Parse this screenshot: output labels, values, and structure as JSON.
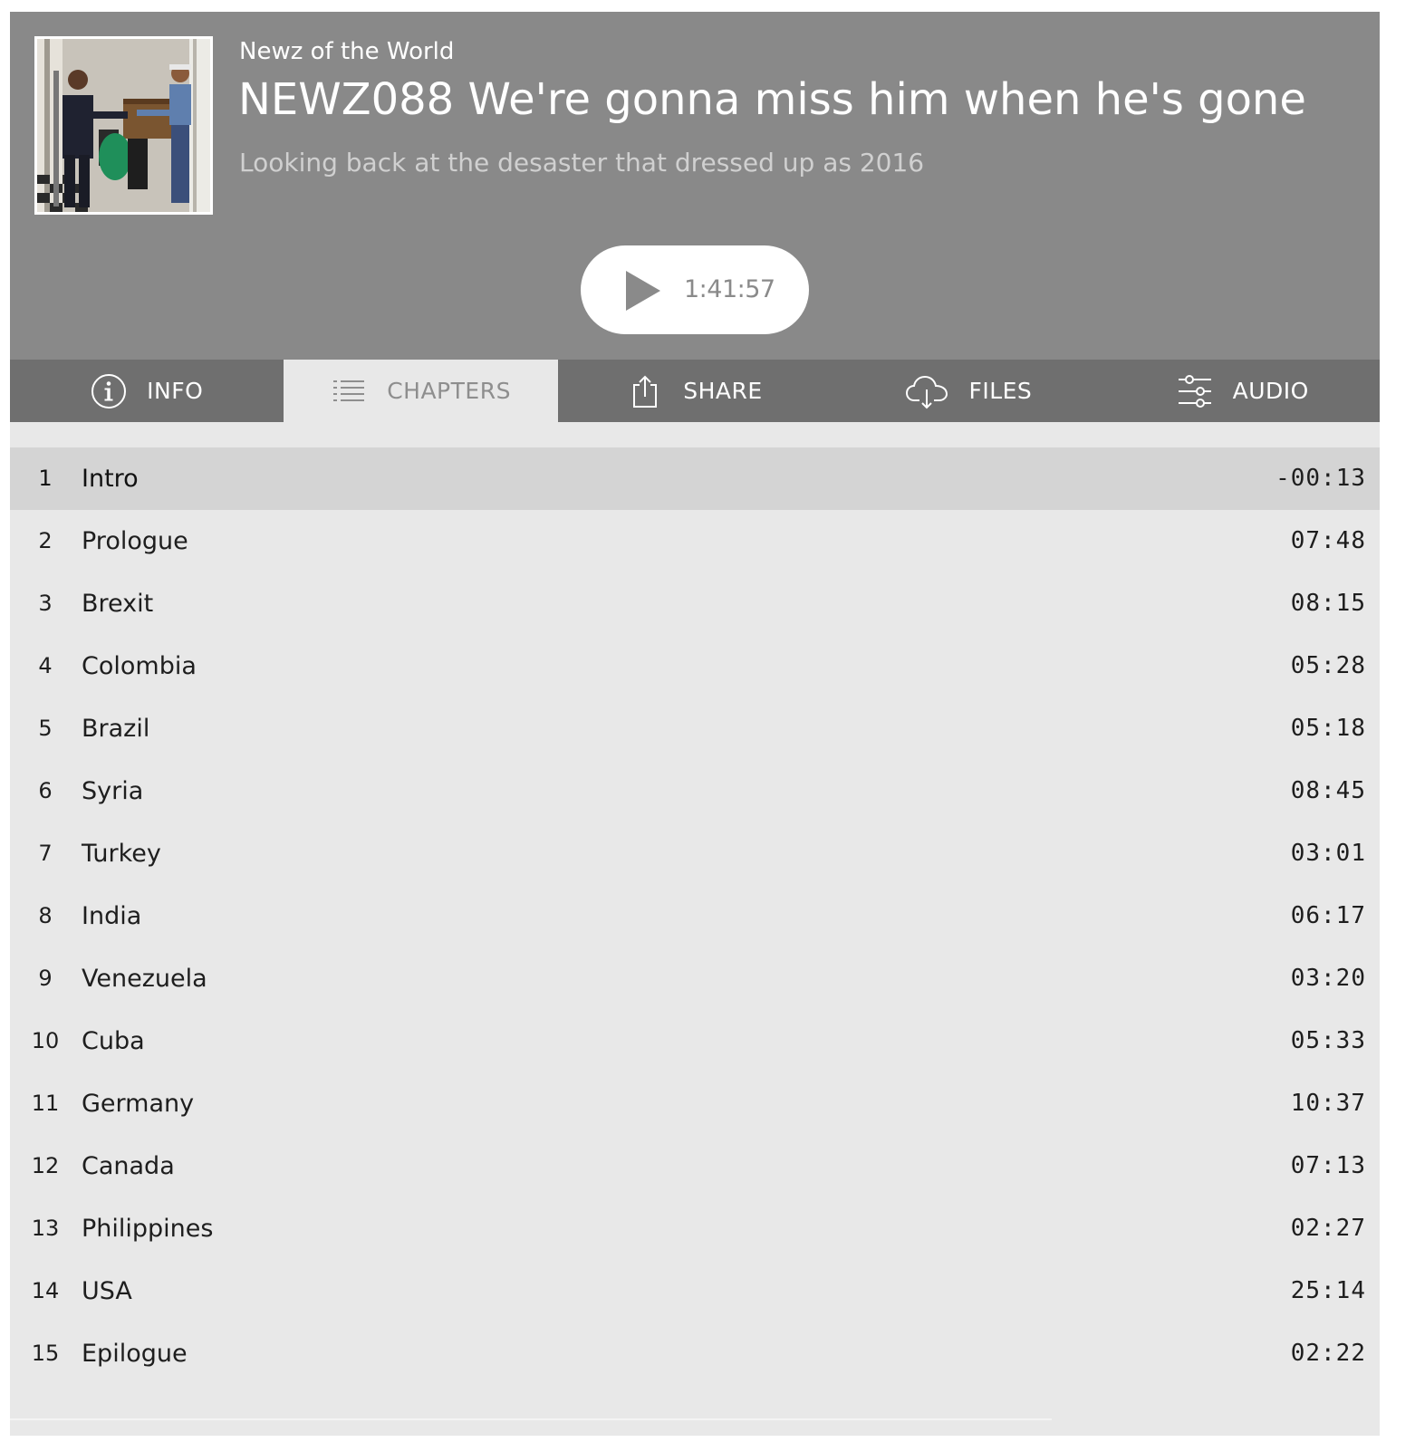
{
  "header": {
    "show_title": "Newz of the World",
    "episode_title": "NEWZ088 We're gonna miss him when he's gone",
    "episode_subtitle": "Looking back at the desaster that dressed up as 2016",
    "cover_icon": "episode-cover-photo",
    "play": {
      "icon": "play-icon",
      "duration": "1:41:57"
    }
  },
  "tabs": [
    {
      "label": "INFO",
      "icon": "info-icon",
      "active": false
    },
    {
      "label": "CHAPTERS",
      "icon": "list-icon",
      "active": true
    },
    {
      "label": "SHARE",
      "icon": "share-icon",
      "active": false
    },
    {
      "label": "FILES",
      "icon": "cloud-download-icon",
      "active": false
    },
    {
      "label": "AUDIO",
      "icon": "sliders-icon",
      "active": false
    }
  ],
  "chapters": [
    {
      "num": "1",
      "title": "Intro",
      "time": "-00:13",
      "active": true
    },
    {
      "num": "2",
      "title": "Prologue",
      "time": "07:48"
    },
    {
      "num": "3",
      "title": "Brexit",
      "time": "08:15"
    },
    {
      "num": "4",
      "title": "Colombia",
      "time": "05:28"
    },
    {
      "num": "5",
      "title": "Brazil",
      "time": "05:18"
    },
    {
      "num": "6",
      "title": "Syria",
      "time": "08:45"
    },
    {
      "num": "7",
      "title": "Turkey",
      "time": "03:01"
    },
    {
      "num": "8",
      "title": "India",
      "time": "06:17"
    },
    {
      "num": "9",
      "title": "Venezuela",
      "time": "03:20"
    },
    {
      "num": "10",
      "title": "Cuba",
      "time": "05:33"
    },
    {
      "num": "11",
      "title": "Germany",
      "time": "10:37"
    },
    {
      "num": "12",
      "title": "Canada",
      "time": "07:13"
    },
    {
      "num": "13",
      "title": "Philippines",
      "time": "02:27"
    },
    {
      "num": "14",
      "title": "USA",
      "time": "25:14"
    },
    {
      "num": "15",
      "title": "Epilogue",
      "time": "02:22"
    }
  ],
  "colors": {
    "header_bg": "#898989",
    "tabbar_bg": "#6f6f6f",
    "content_bg": "#e8e8e8",
    "active_row_bg": "#d4d4d4"
  }
}
